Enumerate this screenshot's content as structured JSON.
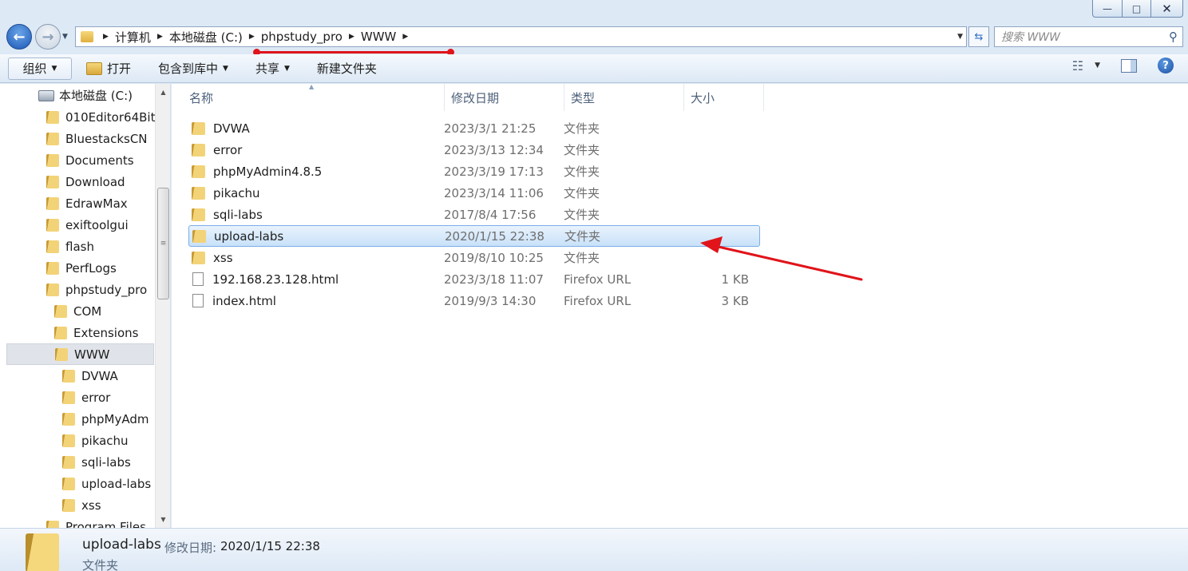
{
  "window": {
    "minimize": "—",
    "maximize": "□",
    "close": "✕"
  },
  "address": {
    "crumbs": [
      "计算机",
      "本地磁盘 (C:)",
      "phpstudy_pro",
      "WWW"
    ],
    "search_placeholder": "搜索 WWW"
  },
  "toolbar": {
    "organize": "组织",
    "open": "打开",
    "include_in_library": "包含到库中",
    "share": "共享",
    "new_folder": "新建文件夹"
  },
  "tree": {
    "drive": "本地磁盘 (C:)",
    "items": [
      "010Editor64Bit",
      "BluestacksCN",
      "Documents",
      "Download",
      "EdrawMax",
      "exiftoolgui",
      "flash",
      "PerfLogs",
      "phpstudy_pro",
      "COM",
      "Extensions",
      "WWW",
      "DVWA",
      "error",
      "phpMyAdm",
      "pikachu",
      "sqli-labs",
      "upload-labs",
      "xss",
      "Program Files"
    ]
  },
  "columns": {
    "name": "名称",
    "date": "修改日期",
    "type": "类型",
    "size": "大小"
  },
  "files": [
    {
      "name": "DVWA",
      "date": "2023/3/1 21:25",
      "type": "文件夹",
      "size": ""
    },
    {
      "name": "error",
      "date": "2023/3/13 12:34",
      "type": "文件夹",
      "size": ""
    },
    {
      "name": "phpMyAdmin4.8.5",
      "date": "2023/3/19 17:13",
      "type": "文件夹",
      "size": ""
    },
    {
      "name": "pikachu",
      "date": "2023/3/14 11:06",
      "type": "文件夹",
      "size": ""
    },
    {
      "name": "sqli-labs",
      "date": "2017/8/4 17:56",
      "type": "文件夹",
      "size": ""
    },
    {
      "name": "upload-labs",
      "date": "2020/1/15 22:38",
      "type": "文件夹",
      "size": ""
    },
    {
      "name": "xss",
      "date": "2019/8/10 10:25",
      "type": "文件夹",
      "size": ""
    },
    {
      "name": "192.168.23.128.html",
      "date": "2023/3/18 11:07",
      "type": "Firefox URL",
      "size": "1 KB"
    },
    {
      "name": "index.html",
      "date": "2019/9/3 14:30",
      "type": "Firefox URL",
      "size": "3 KB"
    }
  ],
  "details": {
    "name": "upload-labs",
    "date_label": "修改日期:",
    "date": "2020/1/15 22:38",
    "type": "文件夹"
  },
  "colors": {
    "annotation_red": "#e0141a",
    "selection_border": "#7aaee8"
  }
}
